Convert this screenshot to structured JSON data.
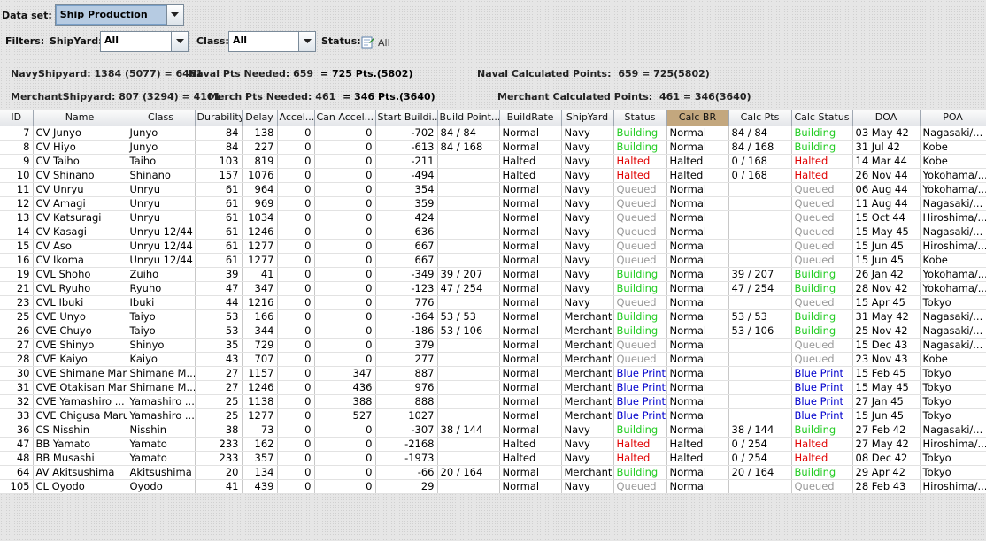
{
  "dataset": {
    "label": "Data set:",
    "value": "Ship Production"
  },
  "filters": {
    "label": "Filters:",
    "shipyard_label": "ShipYard:",
    "shipyard_value": "All",
    "class_label": "Class:",
    "class_value": "All",
    "status_label": "Status:",
    "status_value": "All"
  },
  "stats": {
    "navy_shipyard_label": "NavyShipyard:",
    "navy_shipyard_value": "1384 (5077) = 6461",
    "naval_needed_label": "Naval Pts Needed:",
    "naval_needed_value": "659",
    "naval_needed_result": "= 725 Pts.(5802)",
    "naval_calc_label": "Naval Calculated Points:",
    "naval_calc_value": "659 = 725(5802)",
    "merchant_shipyard_label": "MerchantShipyard:",
    "merchant_shipyard_value": "807 (3294) = 4101",
    "merch_needed_label": "Merch Pts Needed:",
    "merch_needed_value": "461",
    "merch_needed_result": "= 346 Pts.(3640)",
    "merchant_calc_label": "Merchant Calculated Points:",
    "merchant_calc_value": "461 = 346(3640)"
  },
  "colors": {
    "building": "#22cc22",
    "halted": "#e00000",
    "queued": "#999999",
    "blueprint": "#0000cc",
    "highlight_header": "#c3a77e"
  },
  "table": {
    "columns": [
      "ID",
      "Name",
      "Class",
      "Durability",
      "Delay",
      "Accel...",
      "Can Accel...",
      "Start Buildi...",
      "Build Point...",
      "BuildRate",
      "ShipYard",
      "Status",
      "Calc BR",
      "Calc Pts",
      "Calc Status",
      "DOA",
      "POA"
    ],
    "rows": [
      [
        "7",
        "CV Junyo",
        "Junyo",
        "84",
        "138",
        "0",
        "0",
        "-702",
        "84 / 84",
        "Normal",
        "Navy",
        "Building",
        "Normal",
        "84 / 84",
        "Building",
        "03 May 42",
        "Nagasaki/..."
      ],
      [
        "8",
        "CV Hiyo",
        "Junyo",
        "84",
        "227",
        "0",
        "0",
        "-613",
        "84 / 168",
        "Normal",
        "Navy",
        "Building",
        "Normal",
        "84 / 168",
        "Building",
        "31 Jul 42",
        "Kobe"
      ],
      [
        "9",
        "CV Taiho",
        "Taiho",
        "103",
        "819",
        "0",
        "0",
        "-211",
        "",
        "Halted",
        "Navy",
        "Halted",
        "Halted",
        "0 / 168",
        "Halted",
        "14 Mar 44",
        "Kobe"
      ],
      [
        "10",
        "CV Shinano",
        "Shinano",
        "157",
        "1076",
        "0",
        "0",
        "-494",
        "",
        "Halted",
        "Navy",
        "Halted",
        "Halted",
        "0 / 168",
        "Halted",
        "26 Nov 44",
        "Yokohama/..."
      ],
      [
        "11",
        "CV Unryu",
        "Unryu",
        "61",
        "964",
        "0",
        "0",
        "354",
        "",
        "Normal",
        "Navy",
        "Queued",
        "Normal",
        "",
        "Queued",
        "06 Aug 44",
        "Yokohama/..."
      ],
      [
        "12",
        "CV Amagi",
        "Unryu",
        "61",
        "969",
        "0",
        "0",
        "359",
        "",
        "Normal",
        "Navy",
        "Queued",
        "Normal",
        "",
        "Queued",
        "11 Aug 44",
        "Nagasaki/..."
      ],
      [
        "13",
        "CV Katsuragi",
        "Unryu",
        "61",
        "1034",
        "0",
        "0",
        "424",
        "",
        "Normal",
        "Navy",
        "Queued",
        "Normal",
        "",
        "Queued",
        "15 Oct 44",
        "Hiroshima/..."
      ],
      [
        "14",
        "CV Kasagi",
        "Unryu 12/44",
        "61",
        "1246",
        "0",
        "0",
        "636",
        "",
        "Normal",
        "Navy",
        "Queued",
        "Normal",
        "",
        "Queued",
        "15 May 45",
        "Nagasaki/..."
      ],
      [
        "15",
        "CV Aso",
        "Unryu 12/44",
        "61",
        "1277",
        "0",
        "0",
        "667",
        "",
        "Normal",
        "Navy",
        "Queued",
        "Normal",
        "",
        "Queued",
        "15 Jun 45",
        "Hiroshima/..."
      ],
      [
        "16",
        "CV Ikoma",
        "Unryu 12/44",
        "61",
        "1277",
        "0",
        "0",
        "667",
        "",
        "Normal",
        "Navy",
        "Queued",
        "Normal",
        "",
        "Queued",
        "15 Jun 45",
        "Kobe"
      ],
      [
        "19",
        "CVL Shoho",
        "Zuiho",
        "39",
        "41",
        "0",
        "0",
        "-349",
        "39 / 207",
        "Normal",
        "Navy",
        "Building",
        "Normal",
        "39 / 207",
        "Building",
        "26 Jan 42",
        "Yokohama/..."
      ],
      [
        "21",
        "CVL Ryuho",
        "Ryuho",
        "47",
        "347",
        "0",
        "0",
        "-123",
        "47 / 254",
        "Normal",
        "Navy",
        "Building",
        "Normal",
        "47 / 254",
        "Building",
        "28 Nov 42",
        "Yokohama/..."
      ],
      [
        "23",
        "CVL Ibuki",
        "Ibuki",
        "44",
        "1216",
        "0",
        "0",
        "776",
        "",
        "Normal",
        "Navy",
        "Queued",
        "Normal",
        "",
        "Queued",
        "15 Apr 45",
        "Tokyo"
      ],
      [
        "25",
        "CVE Unyo",
        "Taiyo",
        "53",
        "166",
        "0",
        "0",
        "-364",
        "53 / 53",
        "Normal",
        "Merchant",
        "Building",
        "Normal",
        "53 / 53",
        "Building",
        "31 May 42",
        "Nagasaki/..."
      ],
      [
        "26",
        "CVE Chuyo",
        "Taiyo",
        "53",
        "344",
        "0",
        "0",
        "-186",
        "53 / 106",
        "Normal",
        "Merchant",
        "Building",
        "Normal",
        "53 / 106",
        "Building",
        "25 Nov 42",
        "Nagasaki/..."
      ],
      [
        "27",
        "CVE Shinyo",
        "Shinyo",
        "35",
        "729",
        "0",
        "0",
        "379",
        "",
        "Normal",
        "Merchant",
        "Queued",
        "Normal",
        "",
        "Queued",
        "15 Dec 43",
        "Nagasaki/..."
      ],
      [
        "28",
        "CVE Kaiyo",
        "Kaiyo",
        "43",
        "707",
        "0",
        "0",
        "277",
        "",
        "Normal",
        "Merchant",
        "Queued",
        "Normal",
        "",
        "Queued",
        "23 Nov 43",
        "Kobe"
      ],
      [
        "30",
        "CVE Shimane Maru",
        "Shimane M...",
        "27",
        "1157",
        "0",
        "347",
        "887",
        "",
        "Normal",
        "Merchant",
        "Blue Print",
        "Normal",
        "",
        "Blue Print",
        "15 Feb 45",
        "Tokyo"
      ],
      [
        "31",
        "CVE Otakisan Maru",
        "Shimane M...",
        "27",
        "1246",
        "0",
        "436",
        "976",
        "",
        "Normal",
        "Merchant",
        "Blue Print",
        "Normal",
        "",
        "Blue Print",
        "15 May 45",
        "Tokyo"
      ],
      [
        "32",
        "CVE Yamashiro ...",
        "Yamashiro ...",
        "25",
        "1138",
        "0",
        "388",
        "888",
        "",
        "Normal",
        "Merchant",
        "Blue Print",
        "Normal",
        "",
        "Blue Print",
        "27 Jan 45",
        "Tokyo"
      ],
      [
        "33",
        "CVE Chigusa Maru",
        "Yamashiro ...",
        "25",
        "1277",
        "0",
        "527",
        "1027",
        "",
        "Normal",
        "Merchant",
        "Blue Print",
        "Normal",
        "",
        "Blue Print",
        "15 Jun 45",
        "Tokyo"
      ],
      [
        "36",
        "CS Nisshin",
        "Nisshin",
        "38",
        "73",
        "0",
        "0",
        "-307",
        "38 / 144",
        "Normal",
        "Navy",
        "Building",
        "Normal",
        "38 / 144",
        "Building",
        "27 Feb 42",
        "Nagasaki/..."
      ],
      [
        "47",
        "BB Yamato",
        "Yamato",
        "233",
        "162",
        "0",
        "0",
        "-2168",
        "",
        "Halted",
        "Navy",
        "Halted",
        "Halted",
        "0 / 254",
        "Halted",
        "27 May 42",
        "Hiroshima/..."
      ],
      [
        "48",
        "BB Musashi",
        "Yamato",
        "233",
        "357",
        "0",
        "0",
        "-1973",
        "",
        "Halted",
        "Navy",
        "Halted",
        "Halted",
        "0 / 254",
        "Halted",
        "08 Dec 42",
        "Tokyo"
      ],
      [
        "64",
        "AV Akitsushima",
        "Akitsushima",
        "20",
        "134",
        "0",
        "0",
        "-66",
        "20 / 164",
        "Normal",
        "Merchant",
        "Building",
        "Normal",
        "20 / 164",
        "Building",
        "29 Apr 42",
        "Tokyo"
      ],
      [
        "105",
        "CL Oyodo",
        "Oyodo",
        "41",
        "439",
        "0",
        "0",
        "29",
        "",
        "Normal",
        "Navy",
        "Queued",
        "Normal",
        "",
        "Queued",
        "28 Feb 43",
        "Hiroshima/..."
      ]
    ]
  }
}
